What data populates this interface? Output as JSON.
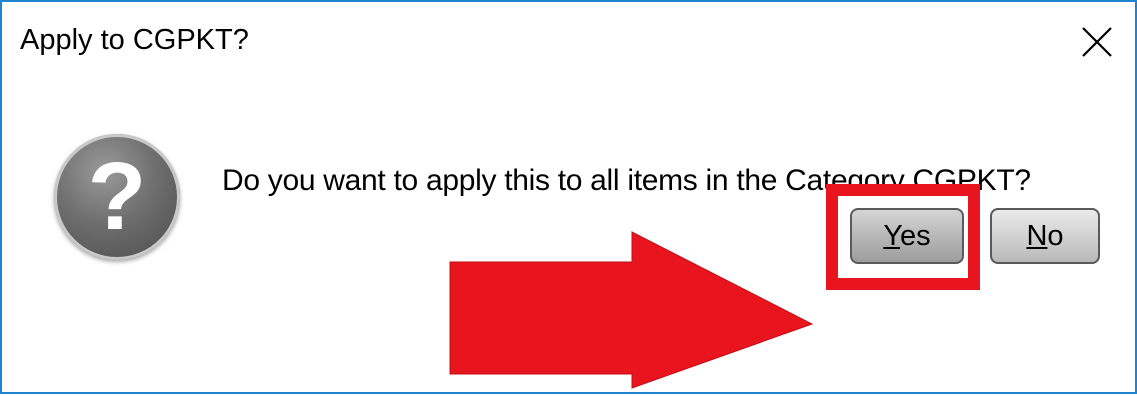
{
  "dialog": {
    "title": "Apply to CGPKT?",
    "message": "Do you want to apply this to all items in the Category CGPKT?",
    "icon": "question-icon",
    "close_icon": "close-icon",
    "buttons": {
      "yes": {
        "mnemonic": "Y",
        "rest": "es"
      },
      "no": {
        "mnemonic": "N",
        "rest": "o"
      }
    }
  },
  "annotation": {
    "arrow_color": "#e8141e",
    "highlight_color": "#e8141e"
  },
  "colors": {
    "window_border": "#1e84d0",
    "icon_bg": "#6e6e6e"
  }
}
